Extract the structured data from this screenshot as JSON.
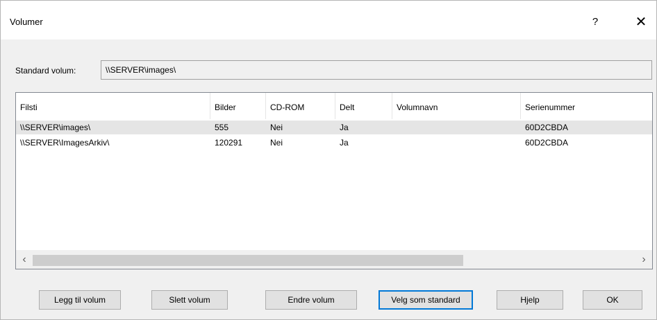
{
  "window": {
    "title": "Volumer",
    "help_glyph": "?",
    "close_glyph": "✕"
  },
  "standard": {
    "label": "Standard volum:",
    "value": "\\\\SERVER\\images\\"
  },
  "table": {
    "columns": [
      "Filsti",
      "Bilder",
      "CD-ROM",
      "Delt",
      "Volumnavn",
      "Serienummer"
    ],
    "rows": [
      {
        "filsti": "\\\\SERVER\\images\\",
        "bilder": "555",
        "cdrom": "Nei",
        "delt": "Ja",
        "volumnavn": "",
        "serienummer": "60D2CBDA"
      },
      {
        "filsti": "\\\\SERVER\\ImagesArkiv\\",
        "bilder": "120291",
        "cdrom": "Nei",
        "delt": "Ja",
        "volumnavn": "",
        "serienummer": "60D2CBDA"
      }
    ]
  },
  "scrollbar": {
    "left_glyph": "‹",
    "right_glyph": "›"
  },
  "buttons": {
    "add": "Legg til volum",
    "delete": "Slett volum",
    "edit": "Endre volum",
    "set_default": "Velg som standard",
    "help": "Hjelp",
    "ok": "OK"
  },
  "colors": {
    "selected_row": "#e5e5e5",
    "default_button_border": "#0078d7"
  }
}
